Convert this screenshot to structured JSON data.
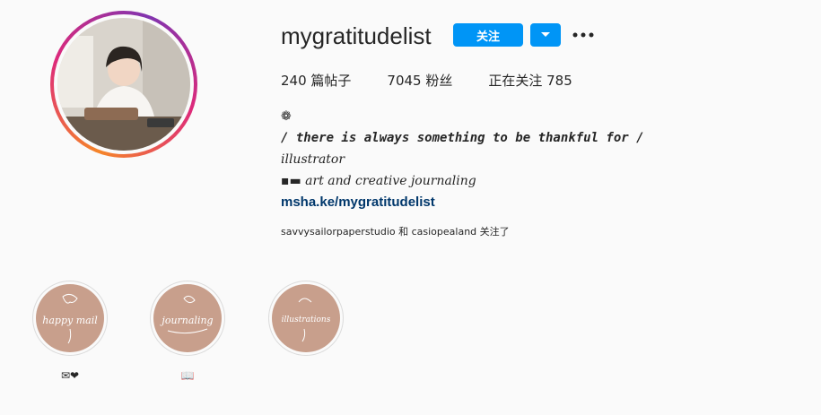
{
  "profile": {
    "username": "mygratitudelist",
    "follow_label": "关注",
    "stats": {
      "posts": "240 篇帖子",
      "followers": "7045 粉丝",
      "following": "正在关注 785"
    },
    "bio": {
      "emoji_line": "   ❁",
      "tagline": "/ there is always something to be thankful for /",
      "role": " illustrator",
      "topic": "▪▬ art and creative journaling",
      "link": "msha.ke/mygratitudelist"
    },
    "followed_by": "savvysailorpaperstudio 和 casiopealand 关注了"
  },
  "highlights": [
    {
      "cover_text": "happy mail",
      "label": "✉❤"
    },
    {
      "cover_text": "journaling",
      "label": "📖"
    },
    {
      "cover_text": "illustrations",
      "label": ""
    }
  ],
  "colors": {
    "accent": "#0095f6",
    "link": "#00376b",
    "highlight_bg": "#c89f8c",
    "ring_start": "#f58529",
    "ring_end": "#dd2a7b"
  },
  "icons": {
    "dropdown": "chevron-down-icon",
    "more": "more-options-icon"
  }
}
